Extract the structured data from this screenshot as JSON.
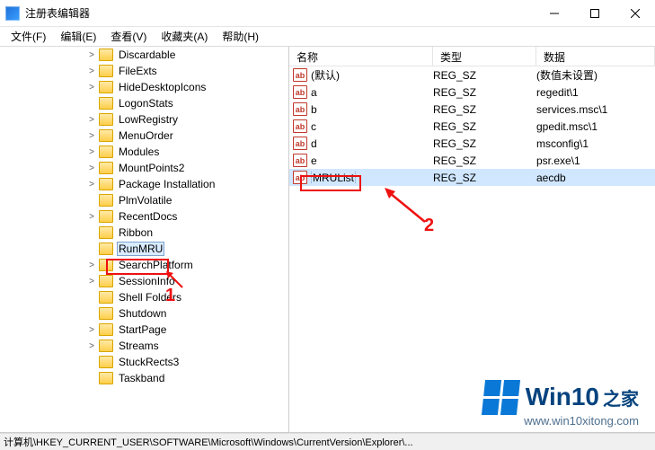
{
  "window": {
    "title": "注册表编辑器"
  },
  "menu": {
    "file": "文件(F)",
    "edit": "编辑(E)",
    "view": "查看(V)",
    "favorites": "收藏夹(A)",
    "help": "帮助(H)"
  },
  "tree": {
    "indent_base": 96,
    "items": [
      {
        "label": "Discardable",
        "expand": ">"
      },
      {
        "label": "FileExts",
        "expand": ">"
      },
      {
        "label": "HideDesktopIcons",
        "expand": ">"
      },
      {
        "label": "LogonStats",
        "expand": ""
      },
      {
        "label": "LowRegistry",
        "expand": ">"
      },
      {
        "label": "MenuOrder",
        "expand": ">"
      },
      {
        "label": "Modules",
        "expand": ">"
      },
      {
        "label": "MountPoints2",
        "expand": ">"
      },
      {
        "label": "Package Installation",
        "expand": ">"
      },
      {
        "label": "PlmVolatile",
        "expand": ""
      },
      {
        "label": "RecentDocs",
        "expand": ">"
      },
      {
        "label": "Ribbon",
        "expand": ""
      },
      {
        "label": "RunMRU",
        "expand": "",
        "selected": true
      },
      {
        "label": "SearchPlatform",
        "expand": ">"
      },
      {
        "label": "SessionInfo",
        "expand": ">"
      },
      {
        "label": "Shell Folders",
        "expand": ""
      },
      {
        "label": "Shutdown",
        "expand": ""
      },
      {
        "label": "StartPage",
        "expand": ">"
      },
      {
        "label": "Streams",
        "expand": ">"
      },
      {
        "label": "StuckRects3",
        "expand": ""
      },
      {
        "label": "Taskband",
        "expand": ""
      }
    ]
  },
  "list": {
    "columns": {
      "name": "名称",
      "type": "类型",
      "data": "数据"
    },
    "rows": [
      {
        "name": "(默认)",
        "type": "REG_SZ",
        "data": "(数值未设置)"
      },
      {
        "name": "a",
        "type": "REG_SZ",
        "data": "regedit\\1"
      },
      {
        "name": "b",
        "type": "REG_SZ",
        "data": "services.msc\\1"
      },
      {
        "name": "c",
        "type": "REG_SZ",
        "data": "gpedit.msc\\1"
      },
      {
        "name": "d",
        "type": "REG_SZ",
        "data": "msconfig\\1"
      },
      {
        "name": "e",
        "type": "REG_SZ",
        "data": "psr.exe\\1"
      },
      {
        "name": "MRUList",
        "type": "REG_SZ",
        "data": "aecdb",
        "selected": true
      }
    ]
  },
  "status": {
    "path": "计算机\\HKEY_CURRENT_USER\\SOFTWARE\\Microsoft\\Windows\\CurrentVersion\\Explorer\\..."
  },
  "annotations": {
    "num1": "1",
    "num2": "2"
  },
  "watermark": {
    "brand": "Win10",
    "suffix": "之家",
    "url": "www.win10xitong.com"
  },
  "icons": {
    "string_value": "ab"
  }
}
